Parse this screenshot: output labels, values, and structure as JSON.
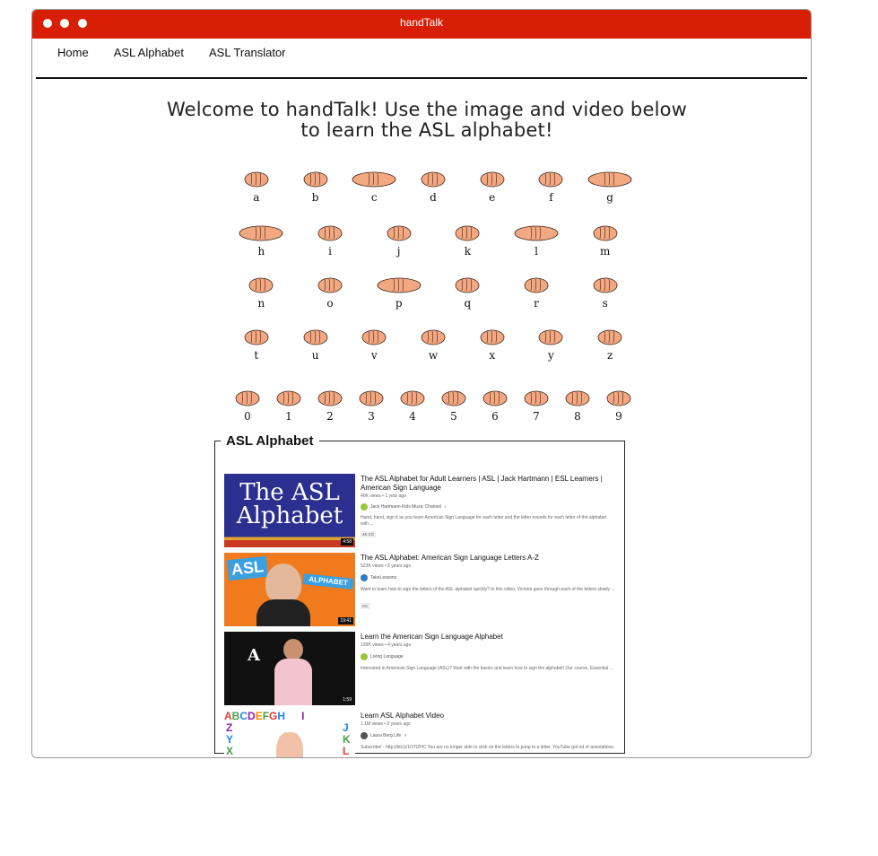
{
  "window": {
    "title": "handTalk"
  },
  "nav": {
    "items": [
      "Home",
      "ASL Alphabet",
      "ASL Translator"
    ]
  },
  "welcome": "Welcome to handTalk! Use the image and video below to learn the ASL alphabet!",
  "alphabet_chart": {
    "rows": [
      [
        "a",
        "b",
        "c",
        "d",
        "e",
        "f",
        "g"
      ],
      [
        "h",
        "i",
        "j",
        "k",
        "l",
        "m"
      ],
      [
        "n",
        "o",
        "p",
        "q",
        "r",
        "s"
      ],
      [
        "t",
        "u",
        "v",
        "w",
        "x",
        "y",
        "z"
      ],
      [
        "0",
        "1",
        "2",
        "3",
        "4",
        "5",
        "6",
        "7",
        "8",
        "9"
      ]
    ]
  },
  "section": {
    "legend": "ASL Alphabet"
  },
  "videos": [
    {
      "title": "The ASL Alphabet for Adult Learners | ASL | Jack Hartmann | ESL Learners | American Sign Language",
      "meta": "40K views • 1 year ago",
      "channel": "Jack Hartmann Kids Music Channel",
      "description": "Hand, hand, sign it as you learn American Sign Language for each letter and the letter sounds for each letter of the alphabet with ...",
      "badges": "4K  CC",
      "duration": "4:58",
      "thumb_text": "The ASL Alphabet"
    },
    {
      "title": "The ASL Alphabet: American Sign Language Letters A-Z",
      "meta": "523K views • 5 years ago",
      "channel": "TakeLessons",
      "description": "Want to learn how to sign the letters of the ASL alphabet quickly? In this video, Victoria goes through each of the letters slowly ...",
      "badges": "CC",
      "duration": "19:41",
      "thumb_text": "ASL"
    },
    {
      "title": "Learn the American Sign Language Alphabet",
      "meta": "139K views • 4 years ago",
      "channel": "Living Language",
      "description": "Interested in American Sign Language (ASL)? Start with the basics and learn how to sign the alphabet! Our course, Essential ...",
      "duration": "1:59",
      "thumb_text": "A"
    },
    {
      "title": "Learn ASL Alphabet Video",
      "meta": "1.1M views • 5 years ago",
      "channel": "Laura Berg Life",
      "description": "Subscribe! - http://bit.ly/1OTlZHC You are no longer able to click on the letters to jump to a letter. YouTube got rid of annotations."
    }
  ],
  "colors": {
    "titlebar": "#d81e05",
    "skin": "#f4a882"
  }
}
